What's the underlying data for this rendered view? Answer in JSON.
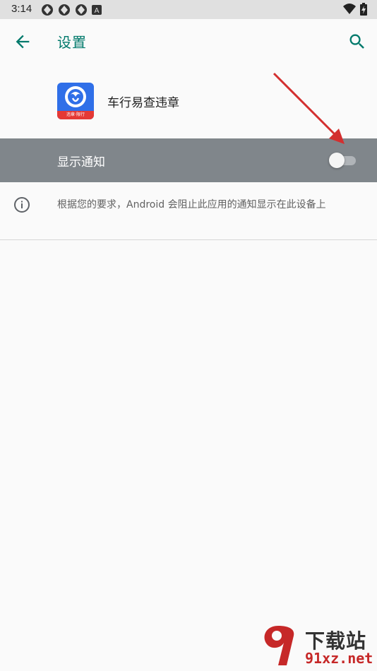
{
  "status_bar": {
    "time": "3:14",
    "left_icons": [
      "notification-icon",
      "notification-icon",
      "notification-icon",
      "a-icon"
    ],
    "right_icons": [
      "wifi-icon",
      "battery-charging-icon"
    ]
  },
  "toolbar": {
    "title": "设置",
    "accent_color": "#00796b"
  },
  "app": {
    "name": "车行易查违章",
    "icon_badge": "违章·限行",
    "icon_color": "#2f6fe8"
  },
  "notification_toggle": {
    "label": "显示通知",
    "state": "off"
  },
  "info": {
    "text": "根据您的要求，Android 会阻止此应用的通知显示在此设备上"
  },
  "watermark": {
    "title": "下载站",
    "url": "91xz.net"
  }
}
